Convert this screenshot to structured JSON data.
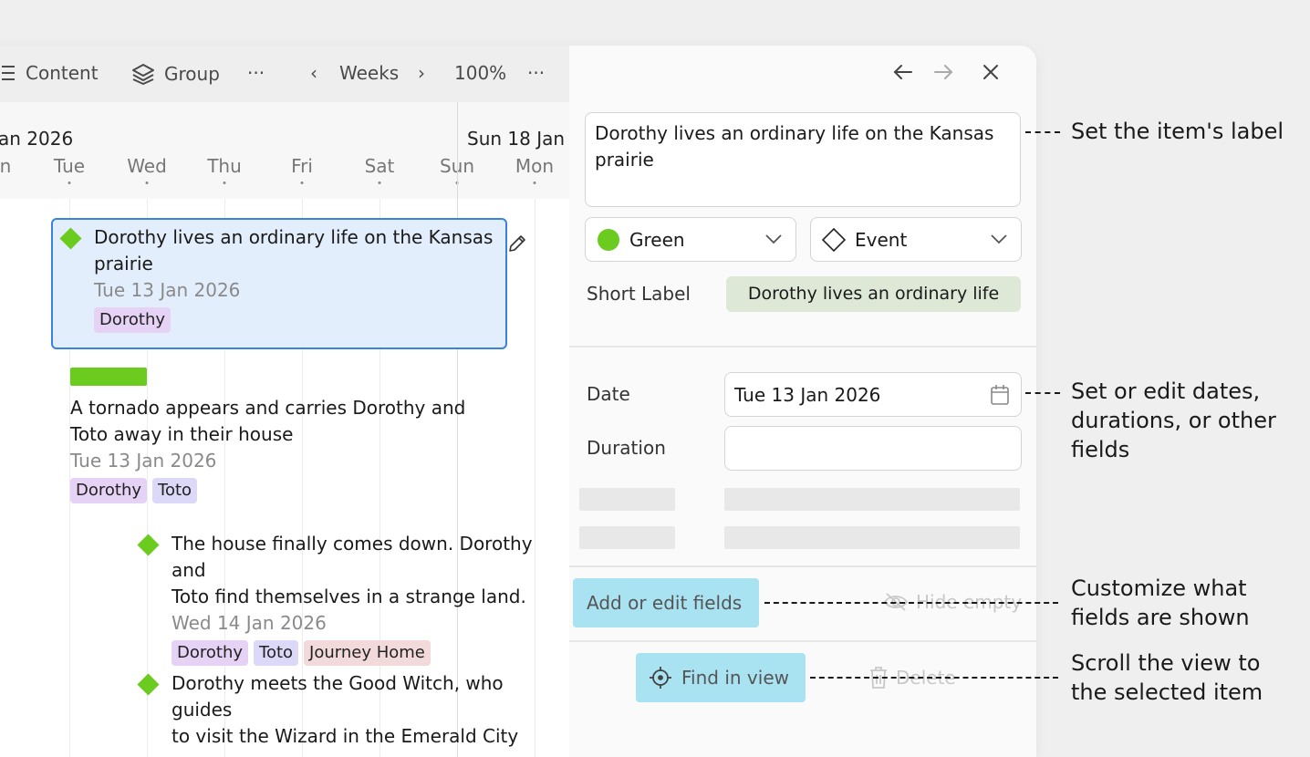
{
  "toolbar": {
    "content_label": "Content",
    "group_label": "Group",
    "more1": "···",
    "prev": "‹",
    "period": "Weeks",
    "next": "›",
    "zoom": "100%",
    "more2": "···"
  },
  "axis": {
    "month_left": "an 2026",
    "month_right": "Sun 18 Jan",
    "days": [
      "n",
      "Tue",
      "Wed",
      "Thu",
      "Fri",
      "Sat",
      "Sun",
      "Mon"
    ]
  },
  "items": [
    {
      "title": "Dorothy lives an ordinary life on the Kansas prairie",
      "title_l1": "Dorothy lives an ordinary life on the Kansas",
      "title_l2": "prairie",
      "date": "Tue 13 Jan 2026",
      "tags": [
        "Dorothy"
      ]
    },
    {
      "title_l1": "A tornado appears and carries Dorothy and",
      "title_l2": "Toto away in their house",
      "date": "Tue 13 Jan 2026",
      "tags": [
        "Dorothy",
        "Toto"
      ]
    },
    {
      "title_l1": "The house finally comes down. Dorothy and",
      "title_l2": "Toto find themselves in a strange land.",
      "date": "Wed 14 Jan 2026",
      "tags": [
        "Dorothy",
        "Toto",
        "Journey Home"
      ]
    },
    {
      "title_l1": "Dorothy meets the Good Witch, who guides",
      "title_l2": "to visit the Wizard in the Emerald City"
    }
  ],
  "panel": {
    "label_l1": "Dorothy lives an ordinary life on the Kansas",
    "label_l2": "prairie",
    "color": {
      "name": "Green",
      "hex": "#6ccb1f"
    },
    "type": "Event",
    "short_label_title": "Short Label",
    "short_label_value": "Dorothy lives an ordinary life",
    "date_label": "Date",
    "date_value": "Tue 13 Jan 2026",
    "duration_label": "Duration",
    "duration_value": "",
    "add_fields": "Add or edit fields",
    "hide_empty": "Hide empty",
    "find_in_view": "Find in view",
    "delete": "Delete"
  },
  "annotations": {
    "a1": "Set the item's label",
    "a2_l1": "Set or edit dates,",
    "a2_l2": "durations, or other",
    "a2_l3": "fields",
    "a3_l1": "Customize what",
    "a3_l2": "fields are shown",
    "a4_l1": "Scroll the view to",
    "a4_l2": "the selected item"
  },
  "colors": {
    "accent_green": "#6ccb1f",
    "selection_blue": "#3b82dd",
    "button_cyan": "#a9e3f2"
  }
}
